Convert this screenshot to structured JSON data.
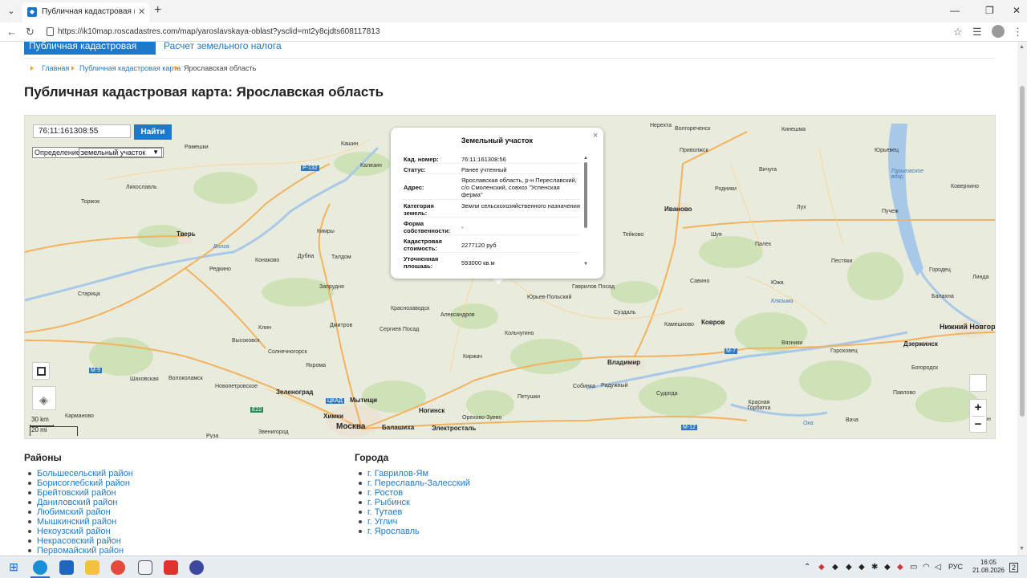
{
  "browser": {
    "tab_title": "Публичная кадастровая карта: Яр",
    "url": "https://ik10map.roscadastres.com/map/yaroslavskaya-oblast?ysclid=mt2y8cjdts608117813"
  },
  "page": {
    "top_nav": {
      "active": "Публичная кадастровая карта",
      "link": "Расчет земельного налога"
    },
    "breadcrumbs": [
      "Главная",
      "Публичная кадастровая карта",
      "Ярославская область"
    ],
    "title": "Публичная кадастровая карта: Ярославская область"
  },
  "map": {
    "search": {
      "value": "76:11:161308:55",
      "button": "Найти"
    },
    "definition": {
      "label": "Определение:",
      "value": "земельный участок"
    },
    "scale": {
      "km": "30 km",
      "mi": "20 mi"
    },
    "zoom_in": "+",
    "zoom_out": "−",
    "labels": [
      {
        "text": "Нерехта"
      },
      {
        "text": "Волгореченск"
      },
      {
        "text": "Кинешма"
      },
      {
        "text": "Кашин"
      },
      {
        "text": "Рамешки"
      },
      {
        "text": "Калязин"
      },
      {
        "text": "Лихославль"
      },
      {
        "text": "Торжок"
      },
      {
        "text": "Тверь"
      },
      {
        "text": "Редкино"
      },
      {
        "text": "Конаково"
      },
      {
        "text": "Дубна"
      },
      {
        "text": "Кимры"
      },
      {
        "text": "Талдом"
      },
      {
        "text": "Запрудня"
      },
      {
        "text": "Старица"
      },
      {
        "text": "Клин"
      },
      {
        "text": "Дмитров"
      },
      {
        "text": "Сергиев Посад"
      },
      {
        "text": "Краснозаводск"
      },
      {
        "text": "Александров"
      },
      {
        "text": "Высоковск"
      },
      {
        "text": "Солнечногорск"
      },
      {
        "text": "Яхрома"
      },
      {
        "text": "Шаховская"
      },
      {
        "text": "Волоколамск"
      },
      {
        "text": "Новопетровское"
      },
      {
        "text": "Зеленоград"
      },
      {
        "text": "Мытищи"
      },
      {
        "text": "Химки"
      },
      {
        "text": "Москва"
      },
      {
        "text": "Балашиха"
      },
      {
        "text": "Ногинск"
      },
      {
        "text": "Электросталь"
      },
      {
        "text": "Орехово-Зуево"
      },
      {
        "text": "Петушки"
      },
      {
        "text": "Киржач"
      },
      {
        "text": "Кольчугино"
      },
      {
        "text": "Юрьев-Польский"
      },
      {
        "text": "Гаврилов Посад"
      },
      {
        "text": "Суздаль"
      },
      {
        "text": "Владимир"
      },
      {
        "text": "Собинка"
      },
      {
        "text": "Радужный"
      },
      {
        "text": "Камешково"
      },
      {
        "text": "Ковров"
      },
      {
        "text": "Судогда"
      },
      {
        "text": "Иваново"
      },
      {
        "text": "Тейково"
      },
      {
        "text": "Шуя"
      },
      {
        "text": "Палех"
      },
      {
        "text": "Савино"
      },
      {
        "text": "Южа"
      },
      {
        "text": "Приволжск"
      },
      {
        "text": "Вичуга"
      },
      {
        "text": "Родники"
      },
      {
        "text": "Лух"
      },
      {
        "text": "Пестяки"
      },
      {
        "text": "Юрьевец"
      },
      {
        "text": "Пучеж"
      },
      {
        "text": "Ковернино"
      },
      {
        "text": "Городец"
      },
      {
        "text": "Линда"
      },
      {
        "text": "Балахна"
      },
      {
        "text": "Нижний Новгор"
      },
      {
        "text": "Дзержинск"
      },
      {
        "text": "Вязники"
      },
      {
        "text": "Гороховец"
      },
      {
        "text": "Богородск"
      },
      {
        "text": "Павлово"
      },
      {
        "text": "Красная Горбатка"
      },
      {
        "text": "Вача"
      },
      {
        "text": "Кон"
      },
      {
        "text": "Кармановo"
      },
      {
        "text": "Руза"
      },
      {
        "text": "Звенигород"
      },
      {
        "text": "Горьковское вдхр."
      },
      {
        "text": "Волга"
      },
      {
        "text": "Клязьма"
      },
      {
        "text": "Ока"
      },
      {
        "text": "Р-132"
      },
      {
        "text": "М-9"
      },
      {
        "text": "М-7"
      },
      {
        "text": "М-12"
      },
      {
        "text": "Е22"
      },
      {
        "text": "ЦКАД"
      }
    ],
    "popup": {
      "title": "Земельный участок",
      "rows": [
        {
          "key": "Кад. номер:",
          "value": "76:11:161308:56"
        },
        {
          "key": "Статус:",
          "value": "Ранее учтенный"
        },
        {
          "key": "Адрес:",
          "value": "Ярославская область, р-н Переславский, с/о Смоленский, совхоз \"Успенская ферма\""
        },
        {
          "key": "Категория земель:",
          "value": "Земли сельскохозяйственного назначения"
        },
        {
          "key": "Форма собственности:",
          "value": "-"
        },
        {
          "key": "Кадастровая стоимость:",
          "value": "2277120 руб"
        },
        {
          "key": "Уточненная площадь:",
          "value": "593000 кв.м"
        }
      ]
    }
  },
  "districts": {
    "title": "Районы",
    "items": [
      "Большесельский район",
      "Борисоглебский район",
      "Брейтовский район",
      "Даниловский район",
      "Любимский район",
      "Мышкинский район",
      "Некоузский район",
      "Некрасовский район",
      "Первомайский район"
    ]
  },
  "cities": {
    "title": "Города",
    "items": [
      "г. Гаврилов-Ям",
      "г. Переславль-Залесский",
      "г. Ростов",
      "г. Рыбинск",
      "г. Тутаев",
      "г. Углич",
      "г. Ярославль"
    ]
  },
  "taskbar": {
    "lang": "РУС",
    "time": "16:05",
    "date": "21.08.2026",
    "notif": "2"
  }
}
